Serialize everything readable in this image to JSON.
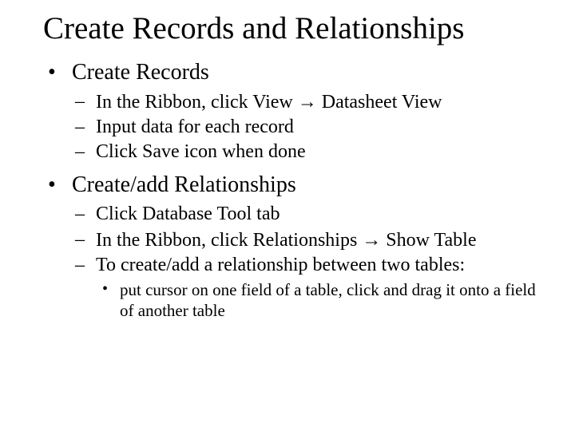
{
  "title": "Create Records and Relationships",
  "bullets": [
    {
      "text": "Create Records",
      "sub": [
        {
          "text_html": "In the Ribbon, click View <span class=\"arrow\">→</span> Datasheet View"
        },
        {
          "text_html": "Input data for each record"
        },
        {
          "text_html": "Click Save icon when done"
        }
      ]
    },
    {
      "text": "Create/add Relationships",
      "sub": [
        {
          "text_html": "Click Database Tool tab"
        },
        {
          "text_html": "In the Ribbon, click Relationships <span class=\"arrow\">→</span> Show Table"
        },
        {
          "text_html": "To create/add a relationship between two tables:",
          "subsub": [
            {
              "text_html": "put cursor on one field of a table, click and drag it onto a field of another table"
            }
          ]
        }
      ]
    }
  ]
}
